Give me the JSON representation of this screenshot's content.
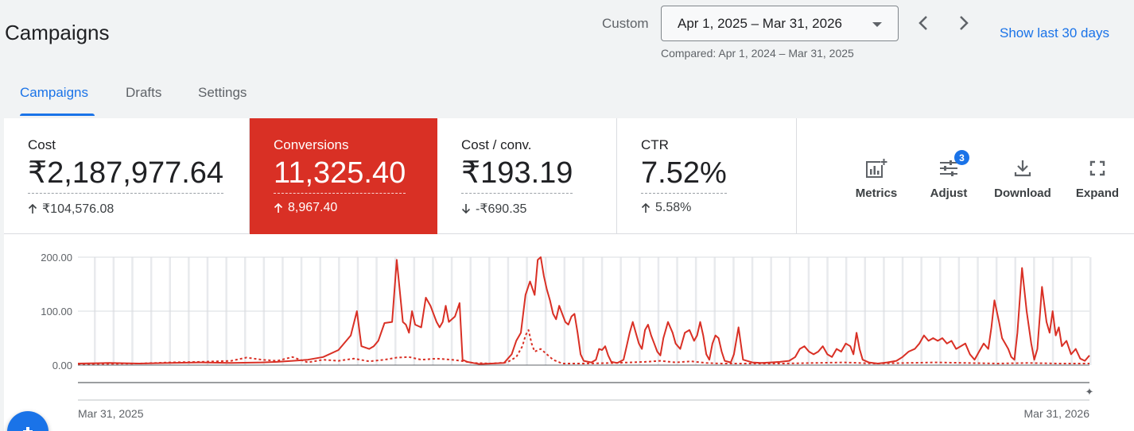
{
  "header": {
    "title": "Campaigns",
    "custom_label": "Custom",
    "date_range": "Apr 1, 2025 – Mar 31, 2026",
    "compared": "Compared: Apr 1, 2024 – Mar 31, 2025",
    "show_last": "Show last 30 days"
  },
  "tabs": [
    {
      "label": "Campaigns",
      "active": true
    },
    {
      "label": "Drafts",
      "active": false
    },
    {
      "label": "Settings",
      "active": false
    }
  ],
  "scorecards": [
    {
      "label": "Cost",
      "value": "₹2,187,977.64",
      "delta": "₹104,576.08",
      "direction": "up",
      "selected": false
    },
    {
      "label": "Conversions",
      "value": "11,325.40",
      "delta": "8,967.40",
      "direction": "up",
      "selected": true
    },
    {
      "label": "Cost / conv.",
      "value": "₹193.19",
      "delta": "-₹690.35",
      "direction": "down",
      "selected": false
    },
    {
      "label": "CTR",
      "value": "7.52%",
      "delta": "5.58%",
      "direction": "up",
      "selected": false
    }
  ],
  "toolbar": {
    "metrics": "Metrics",
    "adjust": "Adjust",
    "adjust_badge": "3",
    "download": "Download",
    "expand": "Expand"
  },
  "colors": {
    "accent": "#1a73e8",
    "selected_card": "#d93025",
    "series": "#d93025"
  },
  "chart_data": {
    "type": "line",
    "x_start": "Mar 31, 2025",
    "x_end": "Mar 31, 2026",
    "xticks": [
      "Mar 31, 2025",
      "Mar 31, 2026"
    ],
    "yticks": [
      "0.00",
      "100.00",
      "200.00"
    ],
    "ylim": [
      0,
      200
    ],
    "grid": true,
    "series": [
      {
        "style": "solid",
        "keypoints": [
          [
            0,
            3
          ],
          [
            20,
            4
          ],
          [
            40,
            3
          ],
          [
            60,
            4
          ],
          [
            80,
            5
          ],
          [
            100,
            4
          ],
          [
            120,
            5
          ],
          [
            130,
            6
          ],
          [
            140,
            8
          ],
          [
            150,
            10
          ],
          [
            160,
            15
          ],
          [
            170,
            28
          ],
          [
            178,
            55
          ],
          [
            182,
            100
          ],
          [
            185,
            35
          ],
          [
            190,
            30
          ],
          [
            193,
            35
          ],
          [
            196,
            45
          ],
          [
            200,
            78
          ],
          [
            205,
            80
          ],
          [
            208,
            195
          ],
          [
            212,
            80
          ],
          [
            214,
            75
          ],
          [
            216,
            60
          ],
          [
            218,
            100
          ],
          [
            220,
            75
          ],
          [
            224,
            70
          ],
          [
            227,
            125
          ],
          [
            230,
            110
          ],
          [
            234,
            80
          ],
          [
            236,
            70
          ],
          [
            238,
            80
          ],
          [
            240,
            110
          ],
          [
            242,
            80
          ],
          [
            246,
            90
          ],
          [
            249,
            115
          ],
          [
            251,
            10
          ],
          [
            254,
            6
          ],
          [
            258,
            4
          ],
          [
            262,
            2
          ],
          [
            270,
            3
          ],
          [
            278,
            4
          ],
          [
            283,
            20
          ],
          [
            286,
            45
          ],
          [
            289,
            60
          ],
          [
            292,
            130
          ],
          [
            295,
            155
          ],
          [
            298,
            130
          ],
          [
            300,
            195
          ],
          [
            302,
            200
          ],
          [
            304,
            165
          ],
          [
            306,
            140
          ],
          [
            308,
            120
          ],
          [
            310,
            95
          ],
          [
            312,
            85
          ],
          [
            314,
            110
          ],
          [
            316,
            95
          ],
          [
            318,
            80
          ],
          [
            320,
            75
          ],
          [
            322,
            90
          ],
          [
            324,
            95
          ],
          [
            326,
            60
          ],
          [
            328,
            20
          ],
          [
            330,
            8
          ],
          [
            335,
            5
          ],
          [
            338,
            10
          ],
          [
            340,
            30
          ],
          [
            342,
            28
          ],
          [
            344,
            35
          ],
          [
            346,
            18
          ],
          [
            348,
            6
          ],
          [
            352,
            4
          ],
          [
            356,
            10
          ],
          [
            358,
            35
          ],
          [
            360,
            60
          ],
          [
            362,
            80
          ],
          [
            364,
            60
          ],
          [
            366,
            40
          ],
          [
            368,
            30
          ],
          [
            370,
            65
          ],
          [
            372,
            75
          ],
          [
            374,
            55
          ],
          [
            376,
            40
          ],
          [
            378,
            25
          ],
          [
            380,
            18
          ],
          [
            382,
            50
          ],
          [
            385,
            80
          ],
          [
            388,
            60
          ],
          [
            390,
            40
          ],
          [
            393,
            30
          ],
          [
            396,
            60
          ],
          [
            399,
            65
          ],
          [
            402,
            45
          ],
          [
            404,
            55
          ],
          [
            406,
            80
          ],
          [
            408,
            55
          ],
          [
            410,
            20
          ],
          [
            412,
            10
          ],
          [
            414,
            40
          ],
          [
            416,
            55
          ],
          [
            418,
            50
          ],
          [
            420,
            25
          ],
          [
            422,
            8
          ],
          [
            426,
            5
          ],
          [
            428,
            20
          ],
          [
            431,
            70
          ],
          [
            434,
            10
          ],
          [
            440,
            5
          ],
          [
            446,
            4
          ],
          [
            452,
            5
          ],
          [
            458,
            6
          ],
          [
            464,
            8
          ],
          [
            468,
            15
          ],
          [
            471,
            30
          ],
          [
            474,
            35
          ],
          [
            477,
            25
          ],
          [
            480,
            20
          ],
          [
            483,
            25
          ],
          [
            486,
            35
          ],
          [
            489,
            20
          ],
          [
            492,
            15
          ],
          [
            495,
            30
          ],
          [
            498,
            25
          ],
          [
            501,
            40
          ],
          [
            504,
            35
          ],
          [
            506,
            20
          ],
          [
            508,
            60
          ],
          [
            510,
            30
          ],
          [
            512,
            10
          ],
          [
            516,
            5
          ],
          [
            522,
            3
          ],
          [
            528,
            5
          ],
          [
            534,
            8
          ],
          [
            538,
            15
          ],
          [
            542,
            25
          ],
          [
            546,
            30
          ],
          [
            549,
            40
          ],
          [
            552,
            55
          ],
          [
            555,
            45
          ],
          [
            558,
            50
          ],
          [
            561,
            45
          ],
          [
            564,
            50
          ],
          [
            567,
            40
          ],
          [
            570,
            45
          ],
          [
            573,
            30
          ],
          [
            576,
            35
          ],
          [
            579,
            40
          ],
          [
            582,
            20
          ],
          [
            585,
            10
          ],
          [
            588,
            25
          ],
          [
            591,
            40
          ],
          [
            594,
            30
          ],
          [
            596,
            70
          ],
          [
            598,
            120
          ],
          [
            601,
            80
          ],
          [
            603,
            50
          ],
          [
            605,
            40
          ],
          [
            607,
            30
          ],
          [
            609,
            15
          ],
          [
            611,
            10
          ],
          [
            613,
            60
          ],
          [
            616,
            180
          ],
          [
            619,
            100
          ],
          [
            622,
            40
          ],
          [
            624,
            10
          ],
          [
            626,
            30
          ],
          [
            629,
            145
          ],
          [
            632,
            80
          ],
          [
            634,
            60
          ],
          [
            636,
            100
          ],
          [
            638,
            55
          ],
          [
            640,
            70
          ],
          [
            642,
            35
          ],
          [
            645,
            45
          ],
          [
            648,
            20
          ],
          [
            651,
            30
          ],
          [
            654,
            12
          ],
          [
            657,
            8
          ],
          [
            660,
            18
          ]
        ]
      },
      {
        "style": "dashed",
        "keypoints": [
          [
            0,
            2
          ],
          [
            40,
            3
          ],
          [
            60,
            5
          ],
          [
            80,
            6
          ],
          [
            100,
            8
          ],
          [
            110,
            14
          ],
          [
            120,
            10
          ],
          [
            130,
            8
          ],
          [
            140,
            15
          ],
          [
            150,
            5
          ],
          [
            160,
            10
          ],
          [
            170,
            8
          ],
          [
            180,
            12
          ],
          [
            190,
            7
          ],
          [
            200,
            10
          ],
          [
            208,
            14
          ],
          [
            216,
            15
          ],
          [
            224,
            10
          ],
          [
            234,
            12
          ],
          [
            244,
            10
          ],
          [
            250,
            8
          ],
          [
            258,
            4
          ],
          [
            270,
            3
          ],
          [
            280,
            5
          ],
          [
            286,
            15
          ],
          [
            290,
            35
          ],
          [
            292,
            55
          ],
          [
            294,
            65
          ],
          [
            296,
            40
          ],
          [
            298,
            25
          ],
          [
            302,
            30
          ],
          [
            306,
            20
          ],
          [
            310,
            10
          ],
          [
            316,
            3
          ],
          [
            330,
            3
          ],
          [
            350,
            4
          ],
          [
            370,
            6
          ],
          [
            380,
            8
          ],
          [
            390,
            5
          ],
          [
            400,
            7
          ],
          [
            410,
            4
          ],
          [
            420,
            3
          ],
          [
            440,
            3
          ],
          [
            460,
            3
          ],
          [
            480,
            4
          ],
          [
            500,
            5
          ],
          [
            520,
            3
          ],
          [
            540,
            4
          ],
          [
            560,
            5
          ],
          [
            580,
            4
          ],
          [
            600,
            3
          ],
          [
            620,
            4
          ],
          [
            640,
            3
          ],
          [
            660,
            3
          ]
        ]
      }
    ]
  }
}
